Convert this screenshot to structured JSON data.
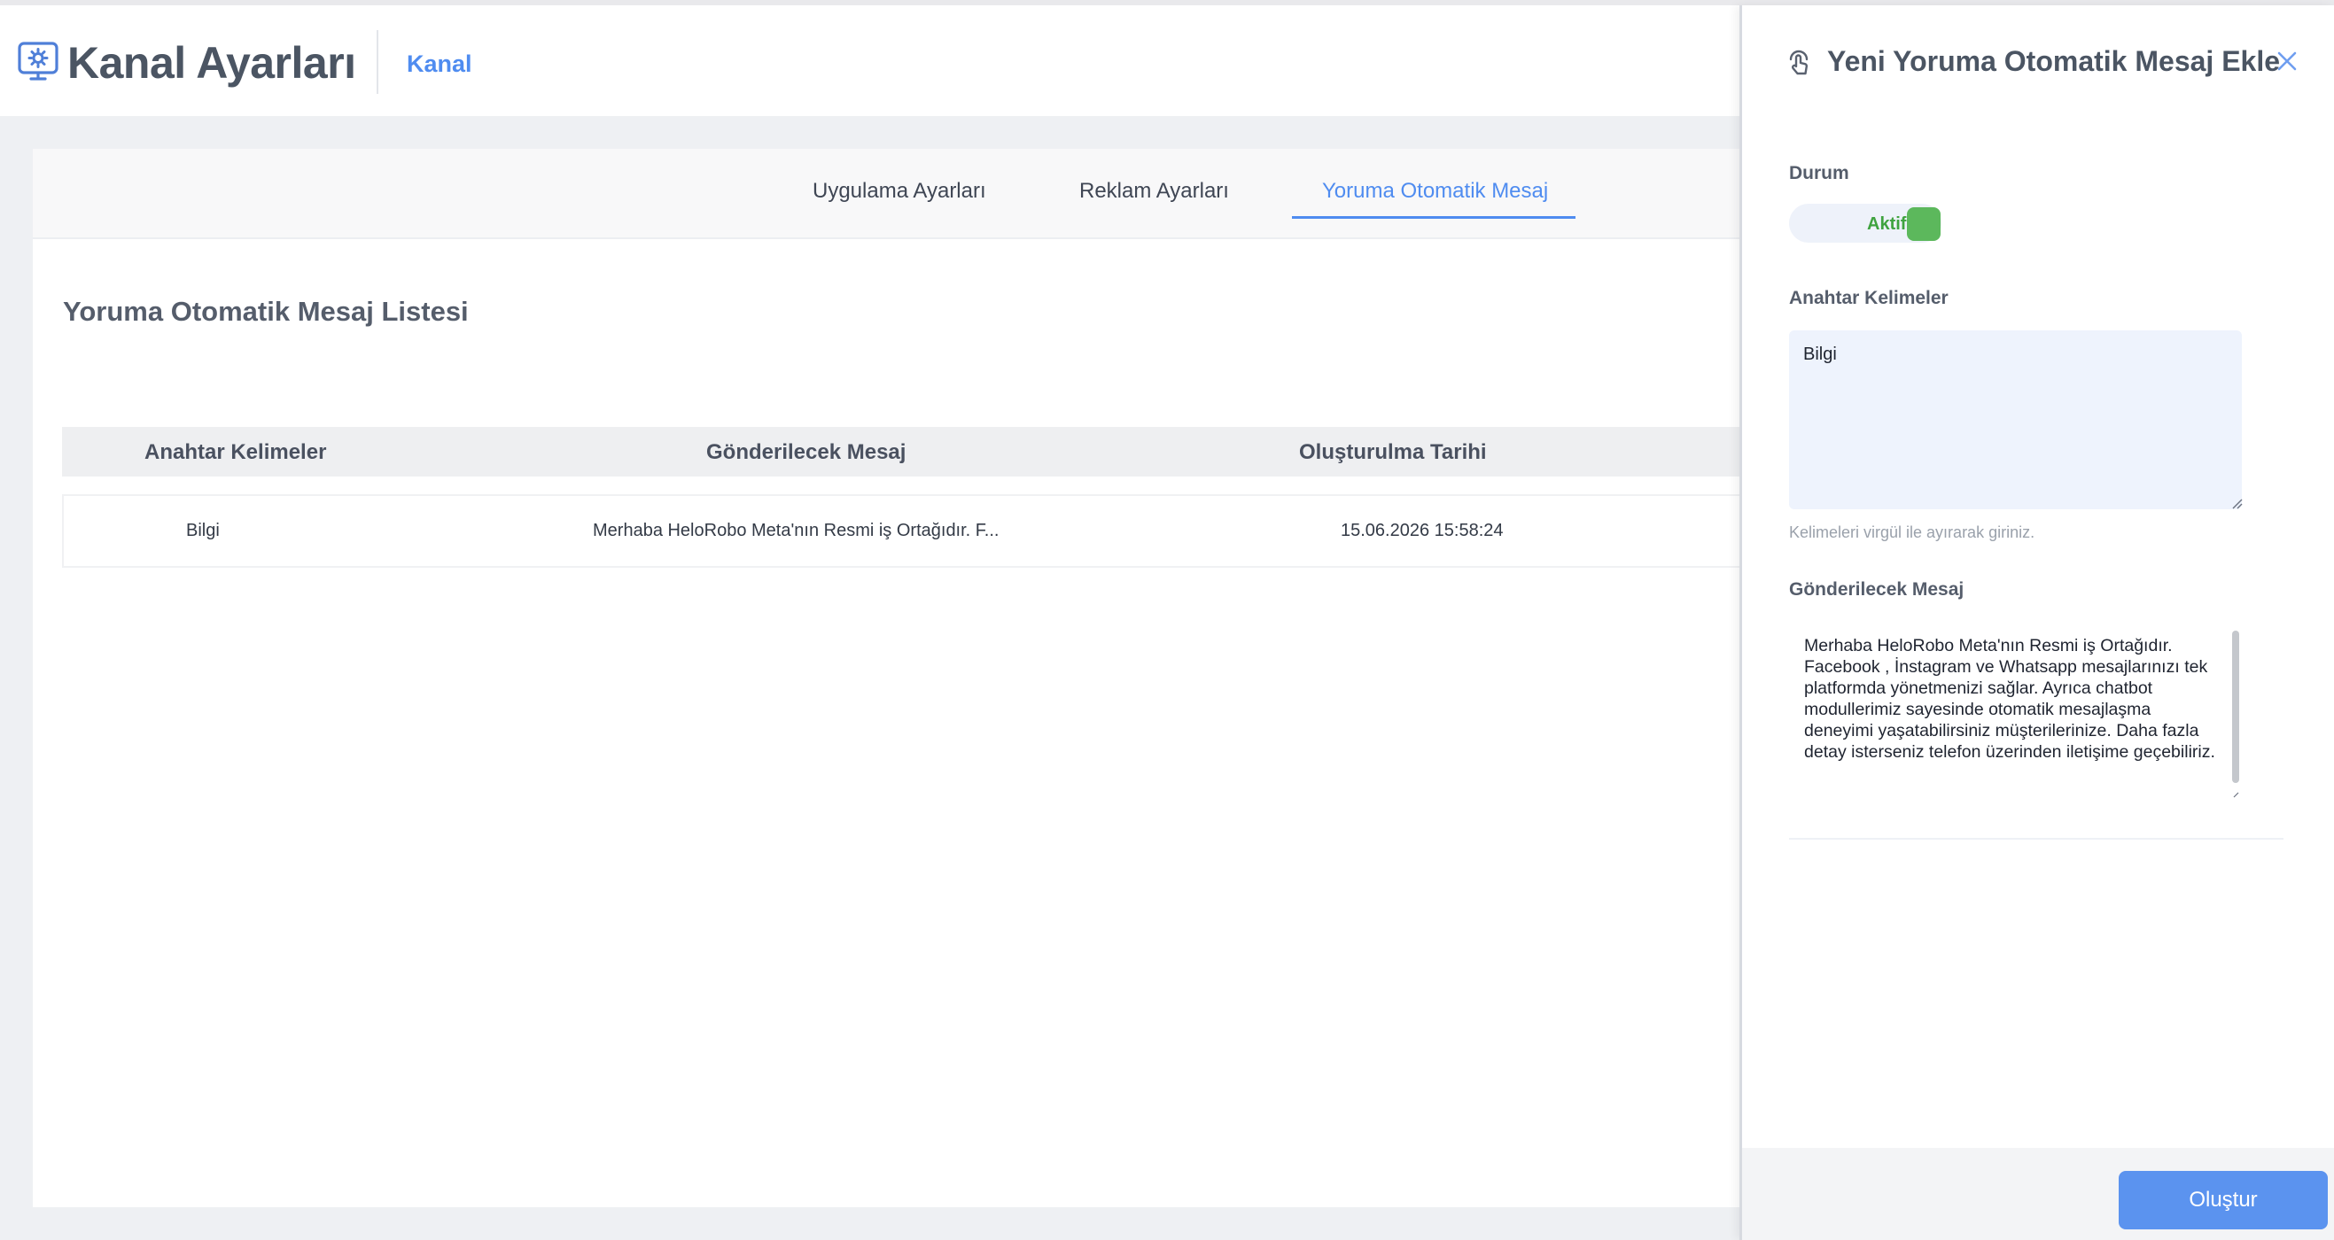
{
  "header": {
    "title": "Kanal Ayarları",
    "breadcrumb": "Kanal",
    "icon": "settings-monitor-icon"
  },
  "tabs": [
    {
      "label": "Uygulama Ayarları",
      "active": false
    },
    {
      "label": "Reklam Ayarları",
      "active": false
    },
    {
      "label": "Yoruma Otomatik Mesaj",
      "active": true
    }
  ],
  "list": {
    "title": "Yoruma Otomatik Mesaj Listesi",
    "columns": [
      "Anahtar Kelimeler",
      "Gönderilecek Mesaj",
      "Oluşturulma Tarihi"
    ],
    "rows": [
      {
        "keywords": "Bilgi",
        "message": "Merhaba HeloRobo Meta'nın Resmi iş Ortağıdır. F...",
        "created": "15.06.2026 15:58:24"
      }
    ]
  },
  "drawer": {
    "title": "Yeni Yoruma Otomatik Mesaj Ekle",
    "icon": "hand-tap-icon",
    "status": {
      "label": "Durum",
      "toggle_label": "Aktif",
      "value": true
    },
    "keywords": {
      "label": "Anahtar Kelimeler",
      "value": "Bilgi",
      "hint": "Kelimeleri virgül ile ayırarak giriniz."
    },
    "message": {
      "label": "Gönderilecek Mesaj",
      "value": "Merhaba HeloRobo Meta'nın Resmi iş Ortağıdır. Facebook , İnstagram ve Whatsapp mesajlarınızı tek platformda yönetmenizi sağlar. Ayrıca chatbot modullerimiz sayesinde otomatik mesajlaşma deneyimi yaşatabilirsiniz müşterilerinize. Daha fazla detay isterseniz telefon üzerinden iletişime geçebiliriz."
    },
    "submit_label": "Oluştur"
  },
  "colors": {
    "accent": "#4f8cf0",
    "active_green": "#5cb85c",
    "button": "#5b93ef"
  }
}
